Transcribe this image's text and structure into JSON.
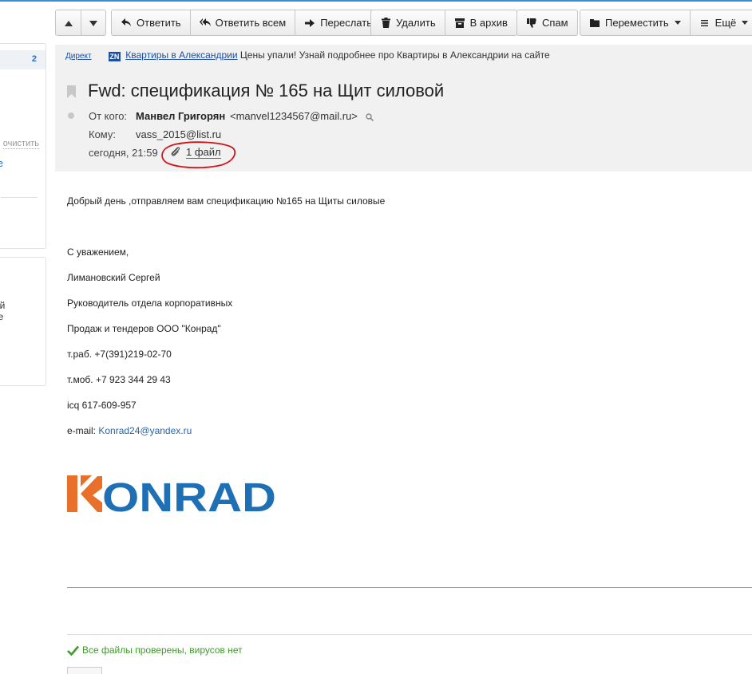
{
  "sidebar": {
    "count": "2",
    "clear_label": "очистить",
    "link_fragment": "те",
    "text_fragment_1": "ый",
    "text_fragment_2": "ее"
  },
  "toolbar": {
    "up_icon": "arrow-up-icon",
    "down_icon": "arrow-down-icon",
    "reply": "Ответить",
    "reply_all": "Ответить всем",
    "forward": "Переслать",
    "delete": "Удалить",
    "archive": "В архив",
    "spam": "Спам",
    "move": "Переместить",
    "more": "Ещё"
  },
  "ad": {
    "label": "Директ",
    "logo": "ZN",
    "link": "Квартиры в Александрии",
    "text": "Цены упали! Узнай подробнее про Квартиры в Александрии на сайте"
  },
  "message": {
    "subject": "Fwd: спецификация № 165 на Щит силовой",
    "from_label": "От кого:",
    "from_name": "Манвел Григорян",
    "from_email": "<manvel1234567@mail.ru>",
    "to_label": "Кому:",
    "to": "vass_2015@list.ru",
    "date": "сегодня, 21:59",
    "files": "1 файл"
  },
  "body": {
    "greeting": "Добрый день ,отправляем вам спецификацию №165 на Щиты силовые",
    "regards": "С уважением,",
    "name": "Лимановский Сергей",
    "position_1": "Руководитель отдела корпоративных",
    "position_2": "Продаж и тендеров ООО \"Конрад\"",
    "phone_work": "т.раб. +7(391)219-02-70",
    "phone_mobile": "т.моб. +7 923 344 29 43",
    "icq": "icq 617-609-957",
    "email_label": "e-mail: ",
    "email": "Konrad24@yandex.ru",
    "logo_text": "ONRAD"
  },
  "virus_check": "Все файлы проверены, вирусов нет",
  "colors": {
    "accent": "#3b8fd8",
    "link": "#1d4e9f",
    "konrad_orange": "#e8702a",
    "konrad_blue": "#1f6fb5",
    "virus_green": "#3f9a2a",
    "annotation_red": "#d0141b"
  }
}
